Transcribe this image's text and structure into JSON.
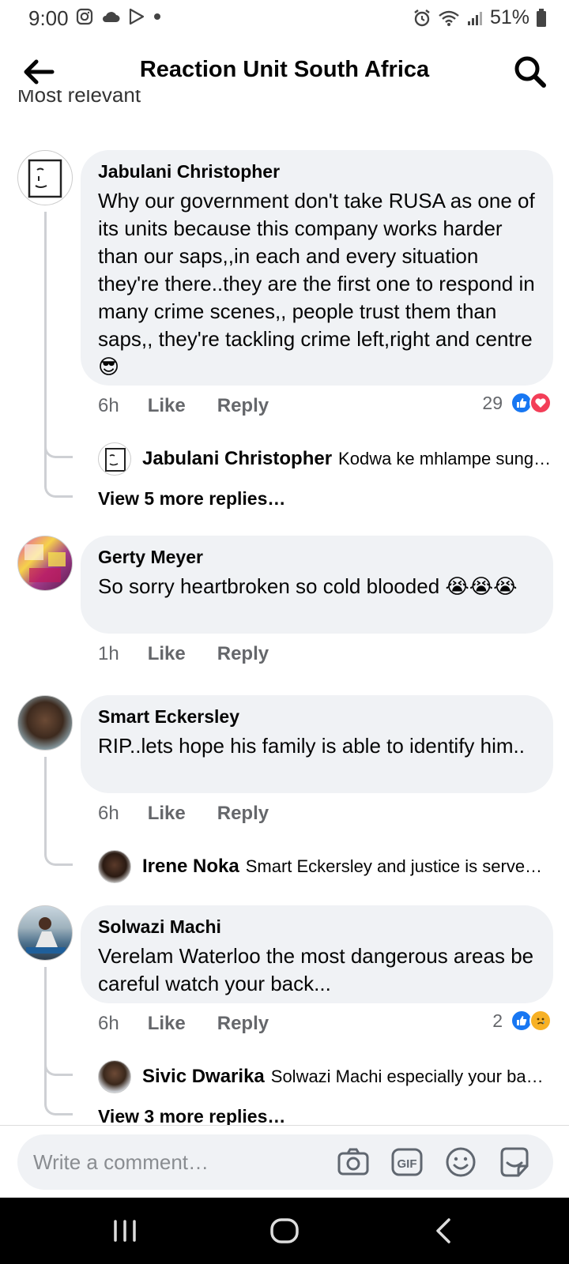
{
  "status_bar": {
    "time": "9:00",
    "battery": "51%"
  },
  "header": {
    "title": "Reaction Unit South Africa"
  },
  "sort": {
    "label": "Most relevant"
  },
  "comments": [
    {
      "author": "Jabulani Christopher",
      "text": "Why our government don't take RUSA as one of its units because this company works harder than our saps,,in each and every situation they're there..they are the first one to respond in many crime scenes,, people trust them than saps,, they're tackling crime left,right and centre😎",
      "time": "6h",
      "like": "Like",
      "reply": "Reply",
      "reaction_count": "29",
      "reply_preview": {
        "author": "Jabulani Christopher",
        "text": "Kodwa ke mhlampe sung…"
      },
      "view_more": "View 5 more replies…"
    },
    {
      "author": "Gerty Meyer",
      "text": "So sorry heartbroken so cold blooded 😭😭😭",
      "time": "1h",
      "like": "Like",
      "reply": "Reply"
    },
    {
      "author": "Smart Eckersley",
      "text": "RIP..lets hope his family is   able to identify him..",
      "time": "6h",
      "like": "Like",
      "reply": "Reply",
      "reply_preview": {
        "author": "Irene Noka",
        "text": "Smart Eckersley and justice is serve…"
      }
    },
    {
      "author": "Solwazi Machi",
      "text": "Verelam Waterloo the most dangerous areas be careful watch your back...",
      "time": "6h",
      "like": "Like",
      "reply": "Reply",
      "reaction_count": "2",
      "reply_preview": {
        "author": "Sivic Dwarika",
        "text": "Solwazi Machi especially your ba…"
      },
      "view_more": "View 3 more replies…"
    }
  ],
  "composer": {
    "placeholder": "Write a comment…"
  },
  "colors": {
    "like_blue": "#1877f2",
    "love_red": "#f33e58",
    "bubble_bg": "#f0f2f5",
    "meta_gray": "#65676b"
  }
}
